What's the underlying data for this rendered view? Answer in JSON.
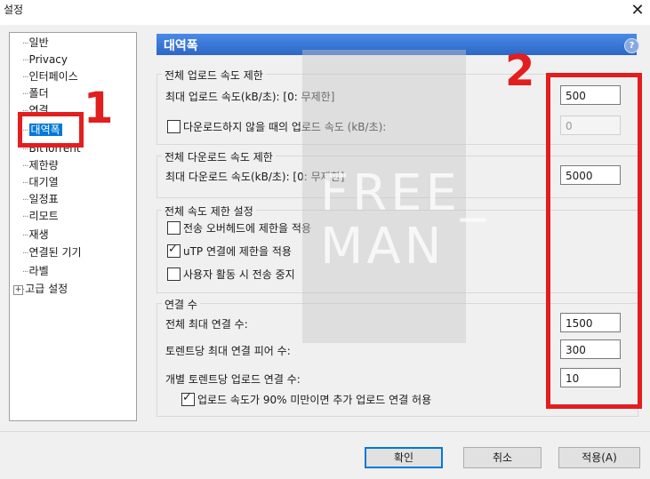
{
  "window": {
    "title": "설정"
  },
  "tree": {
    "items": [
      {
        "label": "일반"
      },
      {
        "label": "Privacy"
      },
      {
        "label": "인터페이스"
      },
      {
        "label": "폴더"
      },
      {
        "label": "연결"
      },
      {
        "label": "대역폭",
        "selected": true
      },
      {
        "label": "BitTorrent"
      },
      {
        "label": "제한량"
      },
      {
        "label": "대기열"
      },
      {
        "label": "일정표"
      },
      {
        "label": "리모트"
      },
      {
        "label": "재생"
      },
      {
        "label": "연결된 기기"
      },
      {
        "label": "라벨"
      },
      {
        "label": "고급 설정",
        "expandable": true
      }
    ]
  },
  "panel": {
    "title": "대역폭",
    "help": "?",
    "upload": {
      "group_title": "전체 업로드 속도 제한",
      "max_label": "최대 업로드 속도(kB/초): [0: 무제한]",
      "max_value": "500",
      "alt_label": "다운로드하지 않을 때의 업로드 속도 (kB/초):",
      "alt_value": "0",
      "alt_checked": false
    },
    "download": {
      "group_title": "전체 다운로드 속도 제한",
      "max_label": "최대 다운로드 속도(kB/초): [0: 무제한]",
      "max_value": "5000"
    },
    "global": {
      "group_title": "전체 속도 제한 설정",
      "opt1_label": "전송 오버헤드에 제한을 적용",
      "opt1_checked": false,
      "opt2_label": "uTP 연결에 제한을 적용",
      "opt2_checked": true,
      "opt3_label": "사용자 활동 시 전송 중지",
      "opt3_checked": false
    },
    "connections": {
      "group_title": "연결 수",
      "max_label": "전체 최대 연결 수:",
      "max_value": "1500",
      "peers_label": "토렌트당 최대 연결 피어 수:",
      "peers_value": "300",
      "slots_label": "개별 토렌트당 업로드 연결 수:",
      "slots_value": "10",
      "extra_label": "업로드 속도가 90% 미만이면 추가 업로드 연결 허용",
      "extra_checked": true
    }
  },
  "buttons": {
    "ok": "확인",
    "cancel": "취소",
    "apply": "적용(A)"
  },
  "watermark": {
    "line1": "FREE_",
    "line2": "MAN"
  },
  "annotations": {
    "n1": "1",
    "n2": "2",
    "color": "#e21e1e"
  }
}
